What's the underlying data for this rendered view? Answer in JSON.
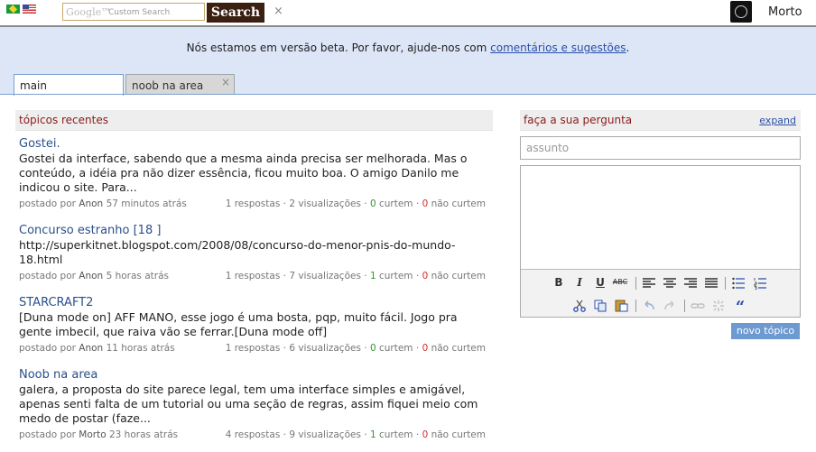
{
  "header": {
    "search_logo": "Google™",
    "search_placeholder": "Custom Search",
    "search_button": "Search",
    "close_glyph": "×",
    "username": "Morto"
  },
  "beta": {
    "text": "Nós estamos em versão beta. Por favor, ajude-nos com ",
    "link": "comentários e sugestões",
    "end": "."
  },
  "tabs": [
    {
      "label": "main"
    },
    {
      "label": "noob na area",
      "close": "×"
    }
  ],
  "recent": {
    "heading": "tópicos recentes",
    "topics": [
      {
        "title": "Gostei.",
        "body": "Gostei da interface, sabendo que a mesma ainda precisa ser melhorada. Mas o conteúdo, a idéia pra não dizer essência, ficou muito boa. O amigo Danilo me indicou o site. Para...",
        "posted": "postado por",
        "author": "Anon",
        "when": "57 minutos atrás",
        "stats": "1 respostas · 2 visualizações ·",
        "likes": "0",
        "likes_label": "curtem ·",
        "dislikes": "0",
        "dislikes_label": "não curtem"
      },
      {
        "title": "Concurso estranho [18 ]",
        "body": "http://superkitnet.blogspot.com/2008/08/concurso-do-menor-pnis-do-mundo-18.html",
        "posted": "postado por",
        "author": "Anon",
        "when": "5 horas atrás",
        "stats": "1 respostas · 7 visualizações ·",
        "likes": "1",
        "likes_label": "curtem ·",
        "dislikes": "0",
        "dislikes_label": "não curtem"
      },
      {
        "title": "STARCRAFT2",
        "body": "[Duna mode on] AFF MANO, esse jogo é uma bosta, pqp, muito fácil. Jogo pra gente imbecil, que raiva vão se ferrar.[Duna mode off]",
        "posted": "postado por",
        "author": "Anon",
        "when": "11 horas atrás",
        "stats": "1 respostas · 6 visualizações ·",
        "likes": "0",
        "likes_label": "curtem ·",
        "dislikes": "0",
        "dislikes_label": "não curtem"
      },
      {
        "title": "Noob na area",
        "body": "galera, a proposta do site parece legal, tem uma interface simples e amigável, apenas senti falta de um tutorial ou uma seção de regras, assim fiquei meio com medo de postar (faze...",
        "posted": "postado por",
        "author": "Morto",
        "when": "23 horas atrás",
        "stats": "4 respostas · 9 visualizações ·",
        "likes": "1",
        "likes_label": "curtem ·",
        "dislikes": "0",
        "dislikes_label": "não curtem"
      }
    ]
  },
  "ask": {
    "heading": "faça a sua pergunta",
    "expand": "expand",
    "subject_placeholder": "assunto",
    "submit": "novo tópico",
    "toolbar": {
      "bold": "B",
      "italic": "I",
      "underline": "U",
      "strike": "ABC",
      "quote": "“"
    }
  },
  "colors": {
    "beta_bg": "#dde6f7",
    "link": "#2a4fa8",
    "heading": "#8b1a1a",
    "like": "#2e9a2e",
    "dislike": "#cc3333",
    "button": "#6d9ad0"
  }
}
